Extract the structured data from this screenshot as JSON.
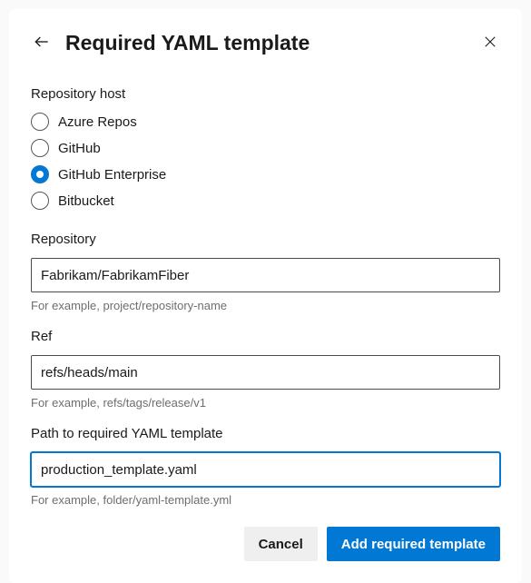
{
  "header": {
    "title": "Required YAML template"
  },
  "hostSection": {
    "label": "Repository host",
    "options": [
      {
        "label": "Azure Repos",
        "selected": false
      },
      {
        "label": "GitHub",
        "selected": false
      },
      {
        "label": "GitHub Enterprise",
        "selected": true
      },
      {
        "label": "Bitbucket",
        "selected": false
      }
    ]
  },
  "repository": {
    "label": "Repository",
    "value": "Fabrikam/FabrikamFiber",
    "hint": "For example, project/repository-name"
  },
  "ref": {
    "label": "Ref",
    "value": "refs/heads/main",
    "hint": "For example, refs/tags/release/v1"
  },
  "path": {
    "label": "Path to required YAML template",
    "value": "production_template.yaml",
    "hint": "For example, folder/yaml-template.yml"
  },
  "footer": {
    "cancel": "Cancel",
    "submit": "Add required template"
  }
}
